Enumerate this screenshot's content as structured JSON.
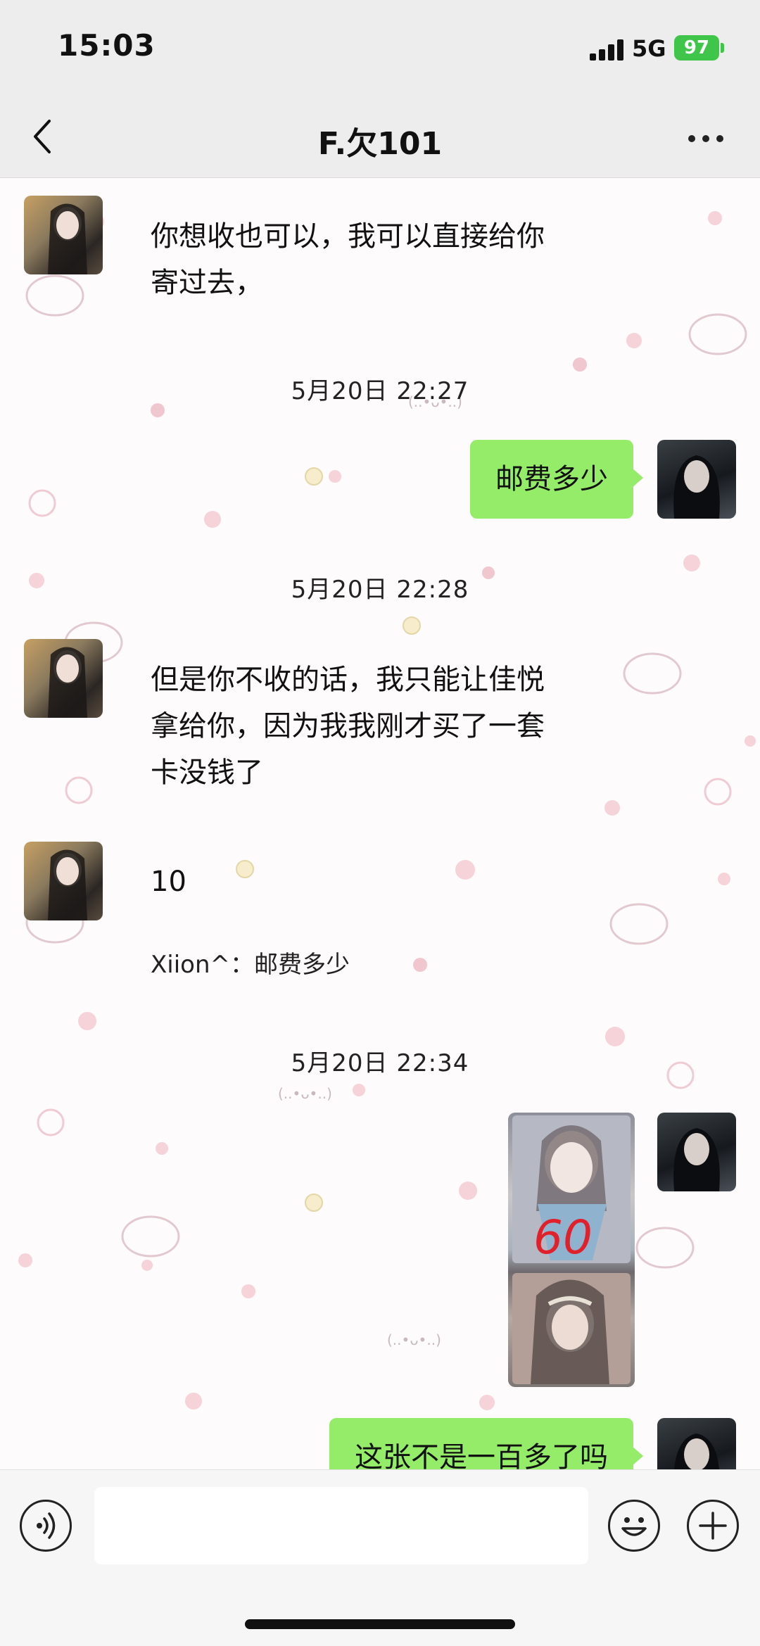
{
  "status_bar": {
    "time": "15:03",
    "network": "5G",
    "battery": "97"
  },
  "nav": {
    "title": "F.欠101"
  },
  "messages": {
    "m1": {
      "line1": "你想收也可以，我可以直接给你",
      "line2": "寄过去，"
    },
    "ts1": "5月20日 22:27",
    "m2": "邮费多少",
    "ts2": "5月20日 22:28",
    "m3": {
      "line1": "但是你不收的话，我只能让佳悦",
      "line2": "拿给你，因为我我刚才买了一套",
      "line3": "卡没钱了"
    },
    "m4": "10",
    "m4_quote": "Xiion^：邮费多少",
    "ts3": "5月20日 22:34",
    "m5": {
      "handwriting": "60"
    },
    "m6": "这张不是一百多了吗"
  },
  "input": {
    "placeholder": ""
  },
  "colors": {
    "outgoing_bubble": "#95ec69",
    "bar_bg": "#ededed",
    "battery": "#3fc64a"
  },
  "icons": {
    "back": "chevron-left-icon",
    "more": "more-dots-icon",
    "voice": "voice-icon",
    "emoji": "emoji-icon",
    "plus": "plus-icon"
  }
}
